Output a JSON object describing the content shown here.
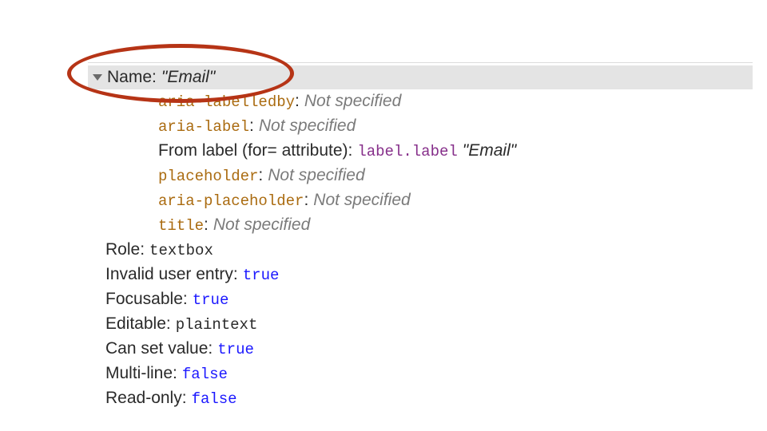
{
  "header": {
    "label": "Name",
    "valueQuoted": "\"Email\""
  },
  "sources": {
    "ariaLabelledby": {
      "name": "aria-labelledby",
      "state": "Not specified"
    },
    "ariaLabel": {
      "name": "aria-label",
      "state": "Not specified"
    },
    "fromLabel": {
      "text": "From label (for= attribute):",
      "tag": "label",
      "cls": "label",
      "valueQuoted": "\"Email\""
    },
    "placeholder": {
      "name": "placeholder",
      "state": "Not specified"
    },
    "ariaPlaceholder": {
      "name": "aria-placeholder",
      "state": "Not specified"
    },
    "title": {
      "name": "title",
      "state": "Not specified"
    }
  },
  "props": {
    "role": {
      "label": "Role",
      "value": "textbox"
    },
    "invalid": {
      "label": "Invalid user entry",
      "value": "true"
    },
    "focusable": {
      "label": "Focusable",
      "value": "true"
    },
    "editable": {
      "label": "Editable",
      "value": "plaintext"
    },
    "canSetValue": {
      "label": "Can set value",
      "value": "true"
    },
    "multiLine": {
      "label": "Multi-line",
      "value": "false"
    },
    "readOnly": {
      "label": "Read-only",
      "value": "false"
    }
  }
}
